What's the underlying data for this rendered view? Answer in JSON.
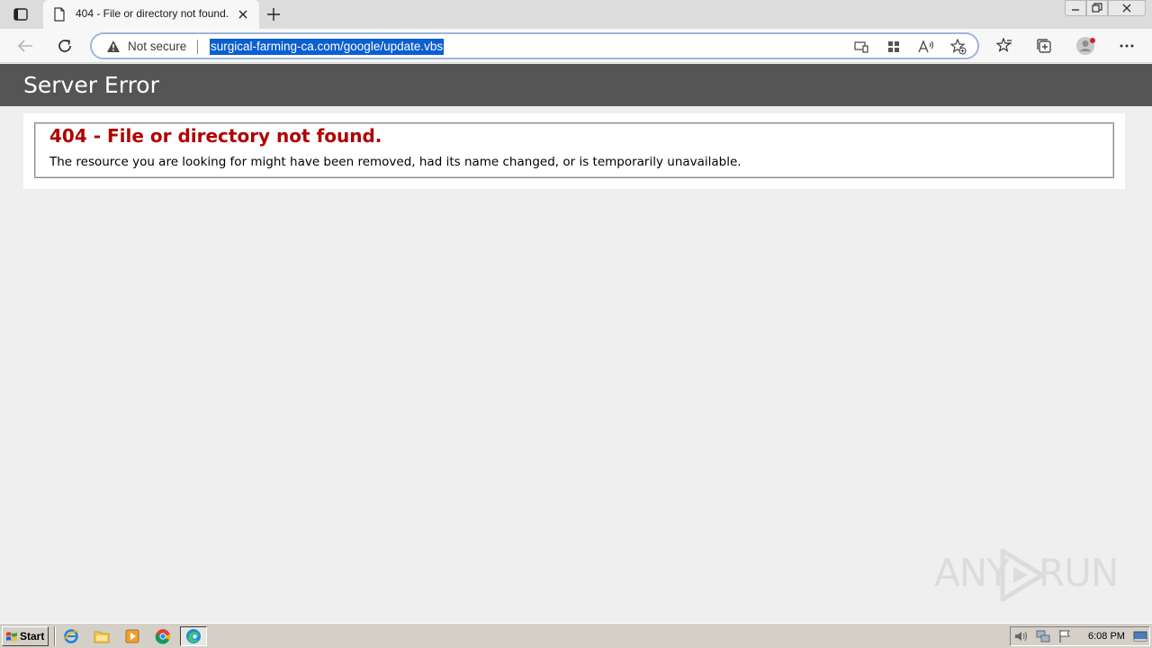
{
  "browser": {
    "tab": {
      "title": "404 - File or directory not found."
    },
    "address_bar": {
      "security_label": "Not secure",
      "url": "surgical-farming-ca.com/google/update.vbs"
    }
  },
  "page": {
    "banner_title": "Server Error",
    "error_heading": "404 - File or directory not found.",
    "error_message": "The resource you are looking for might have been removed, had its name changed, or is temporarily unavailable.",
    "heading_color": "#b00000",
    "banner_color": "#555555"
  },
  "watermark": {
    "left": "ANY",
    "right": "RUN"
  },
  "taskbar": {
    "start_label": "Start",
    "clock": "6:08 PM"
  }
}
